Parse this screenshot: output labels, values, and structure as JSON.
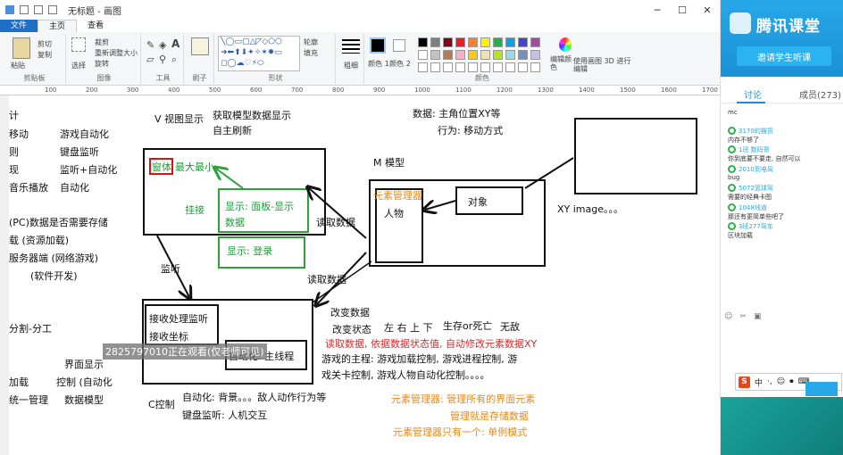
{
  "window": {
    "title": "无标题 - 画图"
  },
  "tabs": {
    "file": "文件",
    "home": "主页",
    "view": "查看"
  },
  "ribbon": {
    "clipboard": {
      "paste": "粘贴",
      "cut": "剪切",
      "copy": "复制",
      "label": "剪贴板"
    },
    "image": {
      "select": "选择",
      "crop": "裁剪",
      "resize": "重新调整大小",
      "rotate": "旋转",
      "label": "图像"
    },
    "tools": {
      "label": "工具"
    },
    "brushes": {
      "label": "刷子"
    },
    "shapes": {
      "outline": "轮廓",
      "fill": "填充",
      "label": "形状"
    },
    "size": {
      "label": "粗细"
    },
    "colors": {
      "color1": "颜色 1",
      "color2": "颜色 2",
      "edit": "编辑颜色",
      "paint3d": "使用画图 3D 进行编辑",
      "label": "颜色"
    }
  },
  "ruler": [
    "100",
    "200",
    "300",
    "400",
    "500",
    "600",
    "700",
    "800",
    "900",
    "1000",
    "1100",
    "1200",
    "1300",
    "1400",
    "1500",
    "1600",
    "1700"
  ],
  "canvas": {
    "left_col": [
      "计",
      "移动",
      "则",
      "现",
      "音乐播放",
      "(PC)数据是否需要存储",
      "载 (资源加载)",
      "服务器端 (网络游戏)",
      "(软件开发)",
      "分割-分工",
      "加载",
      "统一管理"
    ],
    "left_col2": [
      "游戏自动化",
      "键盘监听",
      "监听+自动化",
      "自动化",
      "界面显示",
      "控制 (自动化",
      "数据模型"
    ],
    "v_title": "V 视图显示",
    "v_desc1": "获取模型数据显示",
    "v_desc2": "自主刷新",
    "v_window": "窗体",
    "v_window_rest": "最大最小。",
    "hook": "挂接",
    "show_panel": "显示: 面板-显示数据",
    "show_login": "显示: 登录",
    "listen": "监听",
    "m_title": "M 模型",
    "m_elem_mgr": "元素管理器",
    "m_person": "人物",
    "m_object": "对象",
    "read_data1": "读取数据",
    "read_data2": "读取数据",
    "data_pos": "数据: 主角位置XY等",
    "behavior": "行为: 移动方式",
    "xy_image": "XY image。。。",
    "c_recv": "接收处理监听",
    "c_coord": "接收坐标",
    "c_auto": "自动化: 主线程",
    "c_ctrl": "C控制",
    "change_data": "改变数据",
    "change_state": "改变状态",
    "lrud": "左 右 上 下",
    "life": "生存or死亡",
    "invincible": "无敌",
    "read_by_state": "读取数据, 依据数据状态值, 自动修改元素数据XY",
    "game_main1": "游戏的主程: 游戏加载控制, 游戏进程控制, 游",
    "game_main2": "戏关卡控制, 游戏人物自动化控制。。。。",
    "auto_bg": "自动化: 背景。。。敌人动作行为等",
    "keyboard": "键盘监听: 人机交互",
    "elem1": "元素管理器: 管理所有的界面元素",
    "elem2": "管理就是存储数据",
    "elem3": "元素管理器只有一个: 单例模式",
    "watermark": "2825797010正在观看(仅老师可见)"
  },
  "sidebar": {
    "brand": "腾讯课堂",
    "invite": "邀请学生听课",
    "tab_discuss": "讨论",
    "tab_members": "成员(273)",
    "messages": [
      {
        "name": "",
        "text": "mc"
      },
      {
        "name": "3170的猫员",
        "text": "内存不够了"
      },
      {
        "name": "1班 数码哥",
        "text": "你到底要不要走, 自然可以"
      },
      {
        "name": "2010到电驾",
        "text": "bug"
      },
      {
        "name": "5072篮球驾",
        "text": "需要的经典卡图"
      },
      {
        "name": "1048线道",
        "text": "那还有更简单些吧了"
      },
      {
        "name": "3班277驾车",
        "text": "区块加载"
      }
    ],
    "tools": [
      "☺",
      "✂",
      "▣"
    ]
  },
  "colors": {
    "accent": "#27a8e8",
    "green": "#1c9b3a",
    "orange": "#e8891c",
    "red": "#d12a2a",
    "palette": [
      "#000000",
      "#7f7f7f",
      "#880015",
      "#ed1c24",
      "#ff7f27",
      "#fff200",
      "#22b14c",
      "#00a2e8",
      "#3f48cc",
      "#a349a4",
      "#ffffff",
      "#c3c3c3",
      "#b97a57",
      "#ffaec9",
      "#ffc90e",
      "#efe4b0",
      "#b5e61d",
      "#99d9ea",
      "#7092be",
      "#c8bfe7"
    ]
  }
}
